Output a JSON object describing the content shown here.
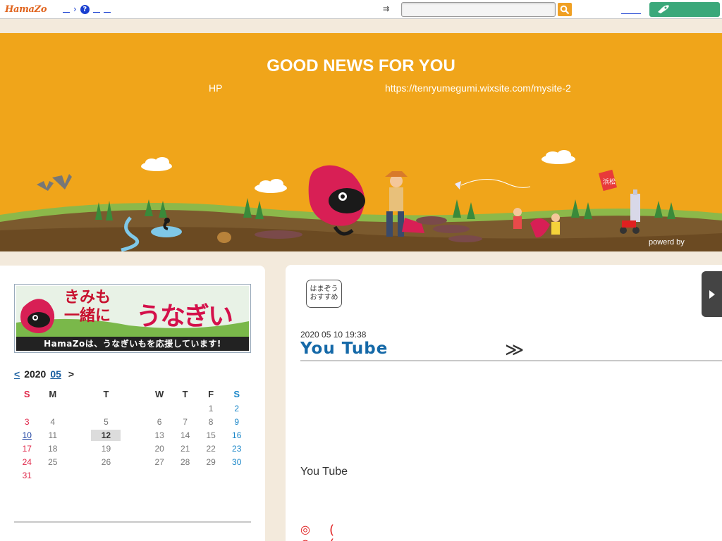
{
  "topbar": {
    "logo": "HamaZo",
    "link_sep": "›",
    "help_icon": "?",
    "search_label": "⇉",
    "search_placeholder": "",
    "search_icon": "search-icon",
    "green_button_icon": "rocket-icon"
  },
  "banner": {
    "title": "GOOD NEWS FOR YOU",
    "hp_label": "HP",
    "url": "https://tenryumegumi.wixsite.com/mysite-2",
    "powered": "powerd by",
    "sign_text": "浜松"
  },
  "colors": {
    "banner_bg": "#f0a51a",
    "accent_blue": "#1569a8",
    "sunday": "#e0284a",
    "saturday": "#1a86c8",
    "green": "#3aa87a"
  },
  "sidebar": {
    "ad_text_line1": "きみも",
    "ad_text_line2": "一緒に",
    "ad_text_big": "うなぎいも。",
    "ad_caption": "HamaZoは、うなぎいもを応援しています!",
    "calendar": {
      "prev": "<",
      "year": "2020",
      "month": "05",
      "next": ">",
      "weekdays": [
        "S",
        "M",
        "T",
        "W",
        "T",
        "F",
        "S"
      ],
      "weeks": [
        [
          "",
          "",
          "",
          "",
          "",
          "1",
          "2"
        ],
        [
          "3",
          "4",
          "5",
          "6",
          "7",
          "8",
          "9"
        ],
        [
          "10",
          "11",
          "12",
          "13",
          "14",
          "15",
          "16"
        ],
        [
          "17",
          "18",
          "19",
          "20",
          "21",
          "22",
          "23"
        ],
        [
          "24",
          "25",
          "26",
          "27",
          "28",
          "29",
          "30"
        ],
        [
          "31",
          "",
          "",
          "",
          "",
          "",
          ""
        ]
      ],
      "today": "12",
      "linked": "10"
    }
  },
  "main": {
    "badge_line1": "はまぞう",
    "badge_line2": "おすすめ",
    "post_date": "2020 05 10  19:38",
    "post_title": "You Tube",
    "post_arrow": "≫",
    "post_body": "You Tube",
    "mark": "◎",
    "paren": "(",
    "side_tab_icon": "triangle-right-icon"
  }
}
